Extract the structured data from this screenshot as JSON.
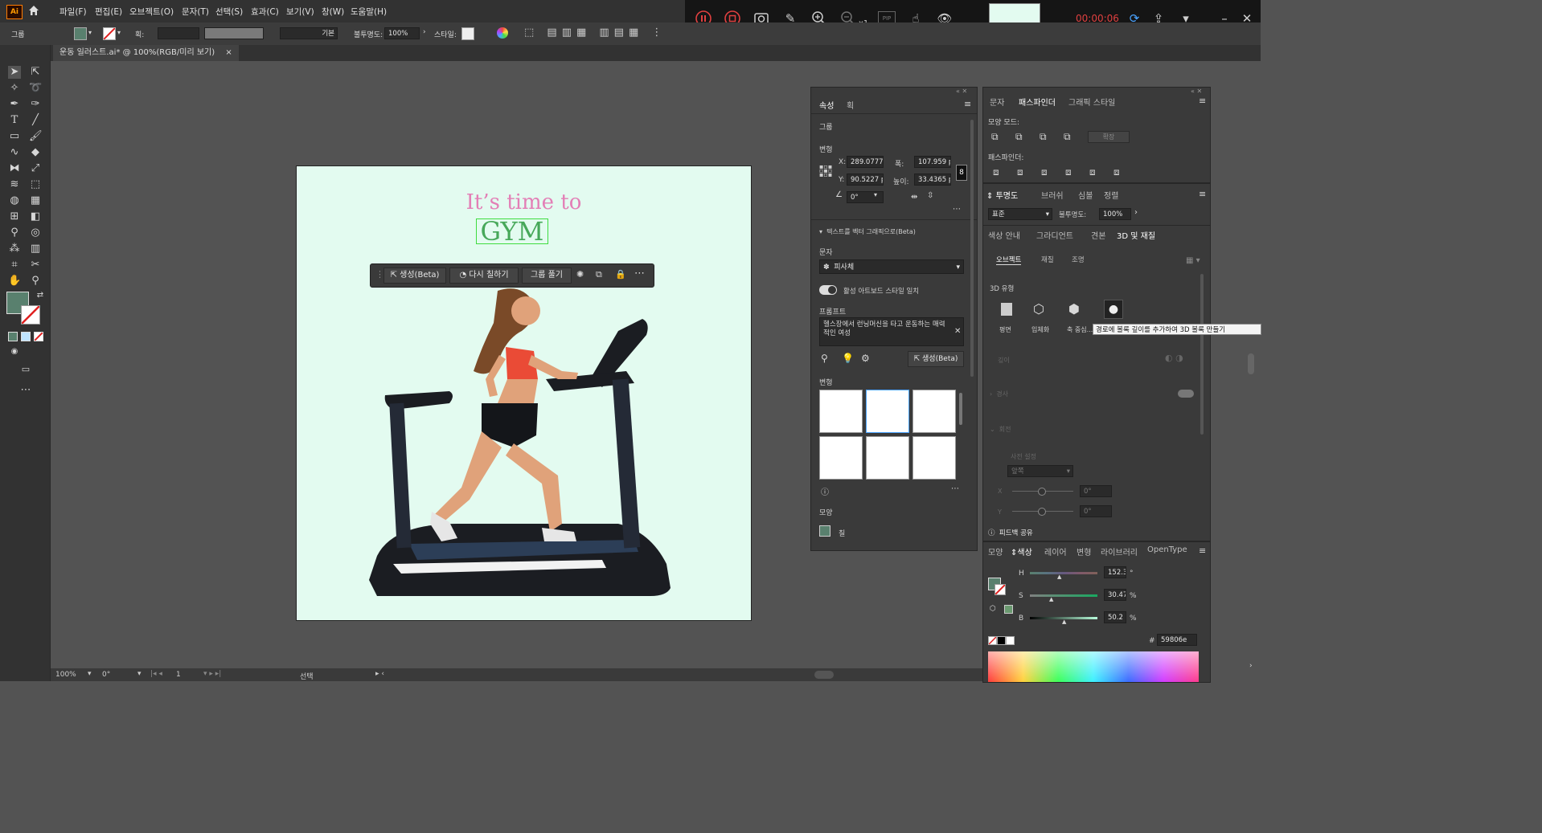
{
  "app": {
    "logo": "Ai"
  },
  "menu": [
    "파일(F)",
    "편집(E)",
    "오브젝트(O)",
    "문자(T)",
    "선택(S)",
    "효과(C)",
    "보기(V)",
    "창(W)",
    "도움말(H)"
  ],
  "control_bar": {
    "selection": "그룹",
    "stroke_label": "획:",
    "stroke_style": "기본",
    "opacity_label": "불투명도:",
    "opacity_value": "100%",
    "style_label": "스타일:"
  },
  "document_tab": {
    "title": "운동 일러스트.ai* @ 100%(RGB/미리 보기)",
    "close": "×"
  },
  "recorder": {
    "time": "00:00:06",
    "speed": "x1",
    "pip": "PIP"
  },
  "artwork": {
    "line1": "It’s time to",
    "line2": "GYM"
  },
  "context_bar": {
    "generate": "생성(Beta)",
    "recolor": "다시 칠하기",
    "ungroup": "그룹 풀기"
  },
  "properties_panel": {
    "tabs": [
      "속성",
      "획"
    ],
    "section_group": "그룹",
    "transform_title": "변형",
    "x_label": "X:",
    "x_value": "289.0777",
    "y_label": "Y:",
    "y_value": "90.5227 p",
    "w_label": "폭:",
    "w_value": "107.959 p",
    "h_label": "높이:",
    "h_value": "33.4365 p",
    "angle_value": "0°",
    "text_to_vector_title": "텍스트를 벡터 그래픽으로(Beta)",
    "subject_label": "문자",
    "subject_value": "피사체",
    "match_style_label": "활성 아트보드 스타일 일치",
    "prompt_label": "프롬프트",
    "prompt_text": "헬스장에서 런닝머신을 타고 운동하는 매력적인 여성",
    "generate_button": "생성(Beta)",
    "variations_label": "변형",
    "appearance_label": "모양",
    "fill_label": "칠"
  },
  "pathfinder_panel": {
    "tabs": [
      "문자",
      "패스파인더",
      "그래픽 스타일"
    ],
    "shape_modes_label": "모양 모드:",
    "expand_button": "확장",
    "pathfinders_label": "패스파인더:"
  },
  "transparency_panel": {
    "tabs": [
      "투명도",
      "브러쉬",
      "심볼",
      "정렬"
    ],
    "blend_mode": "표준",
    "opacity_label": "불투명도:",
    "opacity_value": "100%"
  },
  "threed_panel": {
    "tabs": [
      "색상 안내",
      "그라디언트",
      "견본",
      "3D 및 재질"
    ],
    "subtabs": [
      "오브젝트",
      "재질",
      "조명"
    ],
    "type_label": "3D 유형",
    "types": [
      "평면",
      "입체화",
      "축 중심..."
    ],
    "tooltip": "경로에 볼록 깊이를 추가하여 3D 볼록 만들기",
    "depth_label": "깊이",
    "cap_label": "경사",
    "rotation_label": "회전",
    "preset_label": "사전 설정",
    "preset_value": "앞쪽",
    "x_label": "X",
    "x_value": "0°",
    "y_label": "Y",
    "y_value": "0°",
    "feedback": "피드백 공유"
  },
  "color_panel": {
    "tabs": [
      "모양",
      "색상",
      "레이어",
      "변형",
      "라이브러리",
      "OpenType"
    ],
    "h_label": "H",
    "h_value": "152.3",
    "h_unit": "°",
    "s_label": "S",
    "s_value": "30.47",
    "s_unit": "%",
    "b_label": "B",
    "b_value": "50.2",
    "b_unit": "%",
    "hex_label": "#",
    "hex_value": "59806e"
  },
  "status_bar": {
    "zoom": "100%",
    "rotation": "0°",
    "artboard": "1",
    "tool": "선택"
  },
  "colors": {
    "fill": "#59806e",
    "artboard": "#e3fbf0",
    "record_red": "#e04040"
  }
}
